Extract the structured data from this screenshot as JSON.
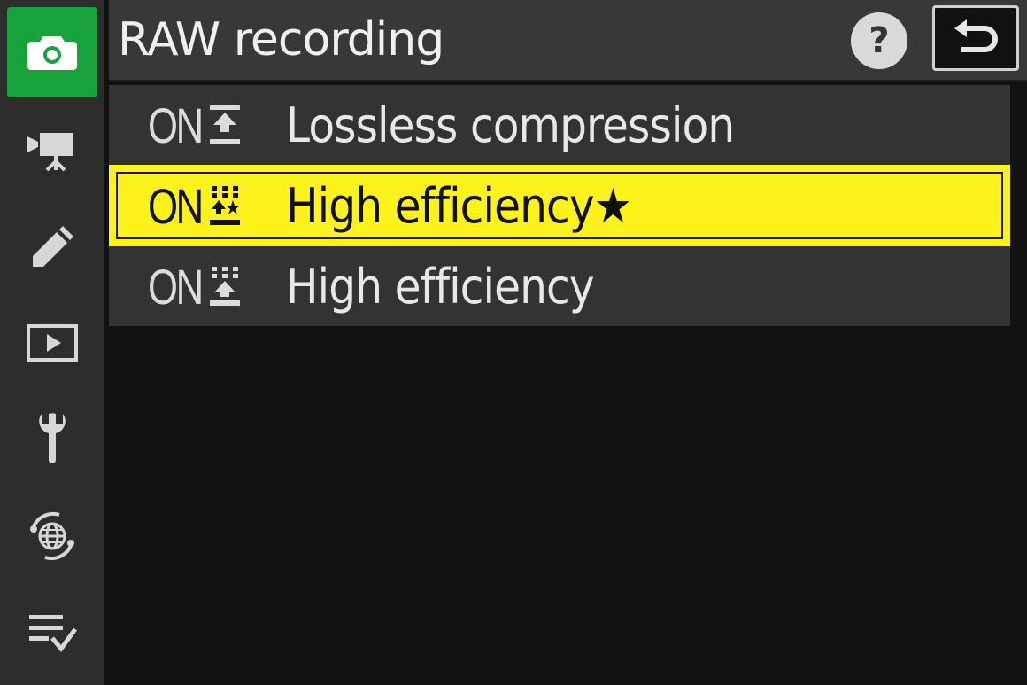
{
  "header": {
    "title": "RAW recording",
    "help_label": "?"
  },
  "sidebar": {
    "items": [
      {
        "icon": "camera-icon",
        "active": true
      },
      {
        "icon": "movie-camera-icon",
        "active": false
      },
      {
        "icon": "pencil-icon",
        "active": false
      },
      {
        "icon": "playback-icon",
        "active": false
      },
      {
        "icon": "wrench-icon",
        "active": false
      },
      {
        "icon": "network-globe-icon",
        "active": false
      },
      {
        "icon": "my-menu-icon",
        "active": false
      }
    ]
  },
  "menu": {
    "items": [
      {
        "prefix": "ON",
        "icon": "lossless-compression-icon",
        "label": "Lossless compression",
        "selected": false
      },
      {
        "prefix": "ON",
        "icon": "high-efficiency-star-icon",
        "label": "High efficiency★",
        "selected": true
      },
      {
        "prefix": "ON",
        "icon": "high-efficiency-icon",
        "label": "High efficiency",
        "selected": false
      }
    ]
  },
  "colors": {
    "accent_green": "#17a23b",
    "highlight_yellow": "#fdf21c",
    "header_bg": "#383838",
    "sidebar_bg": "#2d2d2d"
  }
}
